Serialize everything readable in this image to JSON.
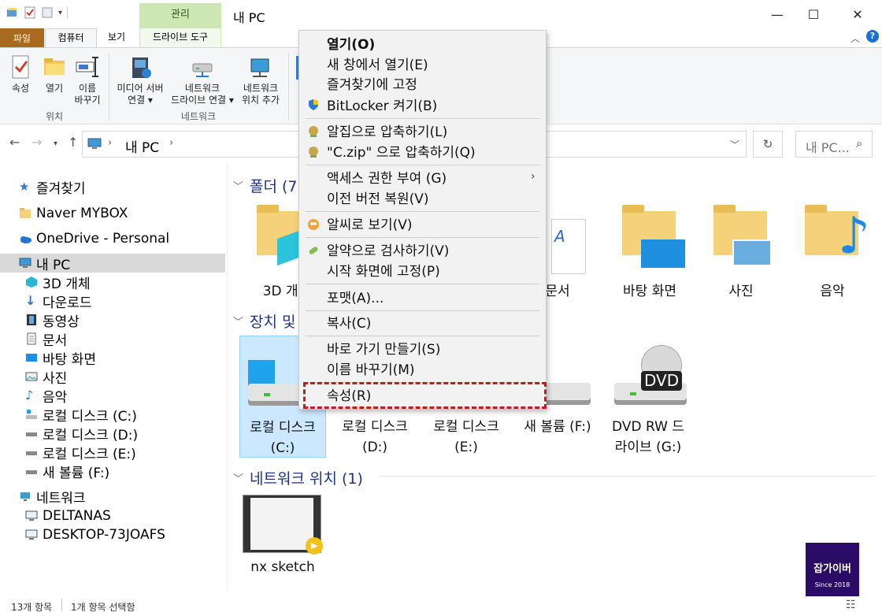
{
  "window": {
    "title": "내 PC",
    "contextual_tab_group": "관리",
    "controls": {
      "minimize": "—",
      "maximize": "☐",
      "close": "✕"
    }
  },
  "ribbon": {
    "tabs": [
      "파일",
      "컴퓨터",
      "보기",
      "드라이브 도구"
    ],
    "location_group": {
      "label": "위치",
      "buttons": [
        {
          "line1": "속성",
          "line2": ""
        },
        {
          "line1": "열기",
          "line2": ""
        },
        {
          "line1": "이름",
          "line2": "바꾸기"
        }
      ]
    },
    "network_group": {
      "label": "네트워크",
      "buttons": [
        {
          "line1": "미디어 서버",
          "line2": "연결 ▾"
        },
        {
          "line1": "네트워크",
          "line2": "드라이브 연결 ▾"
        },
        {
          "line1": "네트워크",
          "line2": "위치 추가"
        }
      ]
    }
  },
  "addressbar": {
    "path": "내 PC",
    "separator": "›",
    "search_placeholder": "내 PC..."
  },
  "nav": {
    "quick_access": "즐겨찾기",
    "mybox": "Naver MYBOX",
    "onedrive": "OneDrive - Personal",
    "this_pc": "내 PC",
    "pc_items": [
      "3D 개체",
      "다운로드",
      "동영상",
      "문서",
      "바탕 화면",
      "사진",
      "음악",
      "로컬 디스크 (C:)",
      "로컬 디스크 (D:)",
      "로컬 디스크 (E:)",
      "새 볼륨 (F:)"
    ],
    "network": "네트워크",
    "network_items": [
      "DELTANAS",
      "DESKTOP-73JOAFS"
    ]
  },
  "content": {
    "folders_header": "폴더 (7",
    "folders": [
      "3D 개체",
      "문서",
      "바탕 화면",
      "사진",
      "음악"
    ],
    "devices_header": "장치 및",
    "drives": [
      {
        "line1": "로컬 디스크",
        "line2": "(C:)"
      },
      {
        "line1": "로컬 디스크",
        "line2": "(D:)"
      },
      {
        "line1": "로컬 디스크",
        "line2": "(E:)"
      },
      {
        "line1": "새 볼륨 (F:)",
        "line2": ""
      },
      {
        "line1": "DVD RW 드",
        "line2": "라이브 (G:)"
      }
    ],
    "dvd_badge": "DVD",
    "network_header": "네트워크 위치 (1)",
    "network_locations": [
      "nx sketch"
    ]
  },
  "statusbar": {
    "item_count": "13개 항목",
    "selected": "1개 항목 선택함"
  },
  "context_menu": {
    "items": [
      {
        "label": "열기(O)",
        "bold": true
      },
      {
        "label": "새 창에서 열기(E)"
      },
      {
        "label": "즐겨찾기에 고정"
      },
      {
        "label": "BitLocker 켜기(B)",
        "icon": "shield-icon"
      },
      {
        "label": "알집으로 압축하기(L)",
        "icon": "alzip-icon"
      },
      {
        "label": "\"C.zip\" 으로 압축하기(Q)",
        "icon": "alzip-icon"
      },
      {
        "label": "액세스 권한 부여 (G)",
        "submenu": true
      },
      {
        "label": "이전 버전 복원(V)"
      },
      {
        "label": "알씨로 보기(V)",
        "icon": "alsee-icon"
      },
      {
        "label": "알약으로 검사하기(V)",
        "icon": "alyac-icon"
      },
      {
        "label": "시작 화면에 고정(P)"
      },
      {
        "label": "포맷(A)..."
      },
      {
        "label": "복사(C)"
      },
      {
        "label": "바로 가기 만들기(S)"
      },
      {
        "label": "이름 바꾸기(M)"
      },
      {
        "label": "속성(R)",
        "highlighted": true
      }
    ],
    "highlight_color": "#c51a1a"
  },
  "watermark": {
    "line1": "잡가이버",
    "line2": "Since 2018"
  },
  "colors": {
    "file_tab": "#a86a1e",
    "contextual_tab": "#cde8b5",
    "selection": "#cce8ff",
    "section_header": "#1e3287"
  }
}
